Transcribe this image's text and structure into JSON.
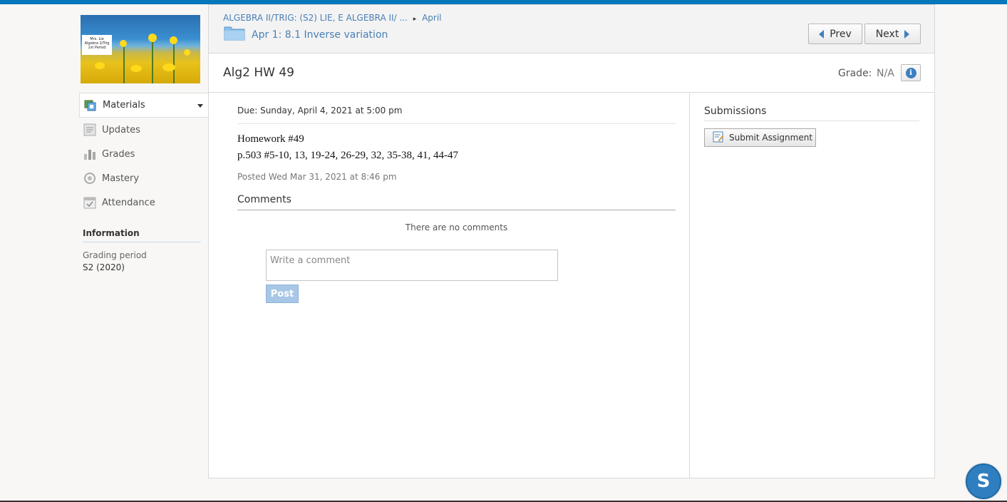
{
  "course": {
    "image_label_lines": [
      "Mrs. Lie",
      "Algebra 2/Trig",
      "1st Period"
    ]
  },
  "sidebar": {
    "items": [
      {
        "label": "Materials",
        "icon": "materials-icon",
        "active": true
      },
      {
        "label": "Updates",
        "icon": "updates-icon"
      },
      {
        "label": "Grades",
        "icon": "grades-icon"
      },
      {
        "label": "Mastery",
        "icon": "mastery-icon"
      },
      {
        "label": "Attendance",
        "icon": "attendance-icon"
      }
    ],
    "information": {
      "heading": "Information",
      "grading_period_label": "Grading period",
      "grading_period_value": "S2 (2020)"
    }
  },
  "header": {
    "breadcrumb": {
      "course": "ALGEBRA II/TRIG: (S2) LIE, E ALGEBRA II/ ...",
      "separator": "▸",
      "folder": "April"
    },
    "folder_title": "Apr 1: 8.1 Inverse variation",
    "prev_label": "Prev",
    "next_label": "Next"
  },
  "assignment": {
    "title": "Alg2 HW 49",
    "grade_label": "Grade:",
    "grade_value": "N/A",
    "due": "Due: Sunday, April 4, 2021 at 5:00 pm",
    "body_line1": "Homework #49",
    "body_line2": "p.503 #5-10, 13, 19-24, 26-29, 32, 35-38, 41, 44-47",
    "posted": "Posted Wed Mar 31, 2021 at 8:46 pm"
  },
  "comments": {
    "heading": "Comments",
    "empty_text": "There are no comments",
    "placeholder": "Write a comment",
    "post_label": "Post"
  },
  "submissions": {
    "heading": "Submissions",
    "submit_label": "Submit Assignment"
  },
  "app_logo_letter": "S",
  "colors": {
    "accent": "#0677ba",
    "link": "#4a7fb5",
    "post_button": "#a8c7e6"
  }
}
